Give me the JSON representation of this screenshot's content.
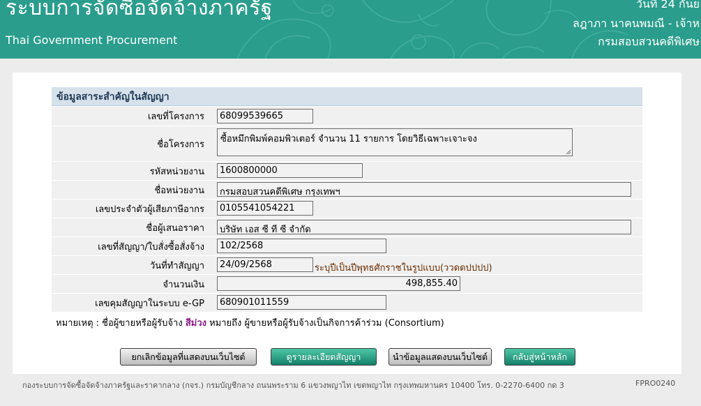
{
  "header": {
    "title": "ระบบการจัดซื้อจัดจ้างภาครัฐ",
    "subtitle": "Thai Government Procurement",
    "date": "วันที่ 24 กันย",
    "user": "ลฎาภา นาคนพมณี - เจ้าห",
    "agency": "กรมสอบสวนคดีพิเศษ"
  },
  "section_title": "ข้อมูลสาระสำคัญในสัญญา",
  "fields": {
    "project_no": {
      "label": "เลขที่โครงการ",
      "value": "68099539665"
    },
    "project_name": {
      "label": "ชื่อโครงการ",
      "value": "ซื้อหมึกพิมพ์คอมพิวเตอร์ จำนวน 11 รายการ โดยวิธีเฉพาะเจาะจง"
    },
    "agency_code": {
      "label": "รหัสหน่วยงาน",
      "value": "1600800000"
    },
    "agency_name": {
      "label": "ชื่อหน่วยงาน",
      "value": "กรมสอบสวนคดีพิเศษ กรุงเทพฯ"
    },
    "tax_id": {
      "label": "เลขประจำตัวผู้เสียภาษีอากร",
      "value": "0105541054221"
    },
    "bidder_name": {
      "label": "ชื่อผู้เสนอราคา",
      "value": "บริษัท เอส ซี ที ซี จำกัด"
    },
    "contract_no": {
      "label": "เลขที่สัญญา/ใบสั่งซื้อสั่งจ้าง",
      "value": "102/2568"
    },
    "contract_date": {
      "label": "วันที่ทำสัญญา",
      "value": "24/09/2568",
      "hint": "ระบุปีเป็นปีพุทธศักราชในรูปแบบ(ววดดปปปป)"
    },
    "amount": {
      "label": "จำนวนเงิน",
      "value": "498,855.40"
    },
    "egp_no": {
      "label": "เลขคุมสัญญาในระบบ e-GP",
      "value": "680901011559"
    }
  },
  "remark": {
    "prefix": "หมายเหตุ : ชื่อผู้ขายหรือผู้รับจ้าง ",
    "highlight": "สีม่วง",
    "suffix": " หมายถึง ผู้ขายหรือผู้รับจ้างเป็นกิจการค้าร่วม (Consortium)",
    "highlight_color": "#8a1a8a"
  },
  "buttons": {
    "cancel_publish": "ยกเลิกข้อมูลที่แสดงบนเว็บไซต์",
    "view_contract": "ดูรายละเอียดสัญญา",
    "publish": "นำข้อมูลแสดงบนเว็บไซต์",
    "back_home": "กลับสู่หน้าหลัก"
  },
  "footer": {
    "text": "กองระบบการจัดซื้อจัดจ้างภาครัฐและราคากลาง (กจร.) กรมบัญชีกลาง ถนนพระราม 6 แขวงพญาไท เขตพญาไท กรุงเทพมหานคร 10400 โทร. 0-2270-6400 กด 3",
    "code": "FPRO0240"
  },
  "colors": {
    "header_bg": "#2a9d8c",
    "section_bg": "#d6e1ec",
    "button_green": "#12806a"
  }
}
